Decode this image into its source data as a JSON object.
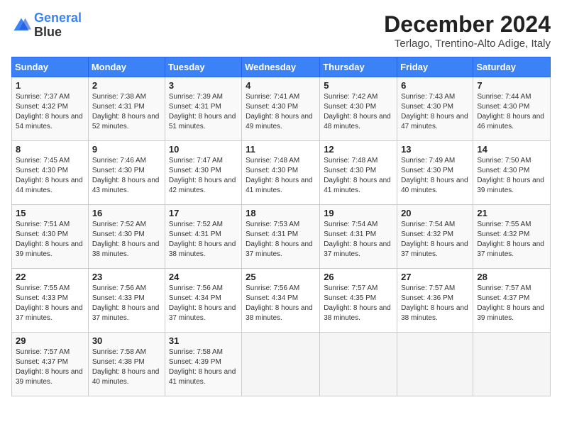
{
  "header": {
    "logo_line1": "General",
    "logo_line2": "Blue",
    "title": "December 2024",
    "subtitle": "Terlago, Trentino-Alto Adige, Italy"
  },
  "columns": [
    "Sunday",
    "Monday",
    "Tuesday",
    "Wednesday",
    "Thursday",
    "Friday",
    "Saturday"
  ],
  "weeks": [
    [
      {
        "day": "1",
        "sunrise": "7:37 AM",
        "sunset": "4:32 PM",
        "daylight": "8 hours and 54 minutes."
      },
      {
        "day": "2",
        "sunrise": "7:38 AM",
        "sunset": "4:31 PM",
        "daylight": "8 hours and 52 minutes."
      },
      {
        "day": "3",
        "sunrise": "7:39 AM",
        "sunset": "4:31 PM",
        "daylight": "8 hours and 51 minutes."
      },
      {
        "day": "4",
        "sunrise": "7:41 AM",
        "sunset": "4:30 PM",
        "daylight": "8 hours and 49 minutes."
      },
      {
        "day": "5",
        "sunrise": "7:42 AM",
        "sunset": "4:30 PM",
        "daylight": "8 hours and 48 minutes."
      },
      {
        "day": "6",
        "sunrise": "7:43 AM",
        "sunset": "4:30 PM",
        "daylight": "8 hours and 47 minutes."
      },
      {
        "day": "7",
        "sunrise": "7:44 AM",
        "sunset": "4:30 PM",
        "daylight": "8 hours and 46 minutes."
      }
    ],
    [
      {
        "day": "8",
        "sunrise": "7:45 AM",
        "sunset": "4:30 PM",
        "daylight": "8 hours and 44 minutes."
      },
      {
        "day": "9",
        "sunrise": "7:46 AM",
        "sunset": "4:30 PM",
        "daylight": "8 hours and 43 minutes."
      },
      {
        "day": "10",
        "sunrise": "7:47 AM",
        "sunset": "4:30 PM",
        "daylight": "8 hours and 42 minutes."
      },
      {
        "day": "11",
        "sunrise": "7:48 AM",
        "sunset": "4:30 PM",
        "daylight": "8 hours and 41 minutes."
      },
      {
        "day": "12",
        "sunrise": "7:48 AM",
        "sunset": "4:30 PM",
        "daylight": "8 hours and 41 minutes."
      },
      {
        "day": "13",
        "sunrise": "7:49 AM",
        "sunset": "4:30 PM",
        "daylight": "8 hours and 40 minutes."
      },
      {
        "day": "14",
        "sunrise": "7:50 AM",
        "sunset": "4:30 PM",
        "daylight": "8 hours and 39 minutes."
      }
    ],
    [
      {
        "day": "15",
        "sunrise": "7:51 AM",
        "sunset": "4:30 PM",
        "daylight": "8 hours and 39 minutes."
      },
      {
        "day": "16",
        "sunrise": "7:52 AM",
        "sunset": "4:30 PM",
        "daylight": "8 hours and 38 minutes."
      },
      {
        "day": "17",
        "sunrise": "7:52 AM",
        "sunset": "4:31 PM",
        "daylight": "8 hours and 38 minutes."
      },
      {
        "day": "18",
        "sunrise": "7:53 AM",
        "sunset": "4:31 PM",
        "daylight": "8 hours and 37 minutes."
      },
      {
        "day": "19",
        "sunrise": "7:54 AM",
        "sunset": "4:31 PM",
        "daylight": "8 hours and 37 minutes."
      },
      {
        "day": "20",
        "sunrise": "7:54 AM",
        "sunset": "4:32 PM",
        "daylight": "8 hours and 37 minutes."
      },
      {
        "day": "21",
        "sunrise": "7:55 AM",
        "sunset": "4:32 PM",
        "daylight": "8 hours and 37 minutes."
      }
    ],
    [
      {
        "day": "22",
        "sunrise": "7:55 AM",
        "sunset": "4:33 PM",
        "daylight": "8 hours and 37 minutes."
      },
      {
        "day": "23",
        "sunrise": "7:56 AM",
        "sunset": "4:33 PM",
        "daylight": "8 hours and 37 minutes."
      },
      {
        "day": "24",
        "sunrise": "7:56 AM",
        "sunset": "4:34 PM",
        "daylight": "8 hours and 37 minutes."
      },
      {
        "day": "25",
        "sunrise": "7:56 AM",
        "sunset": "4:34 PM",
        "daylight": "8 hours and 38 minutes."
      },
      {
        "day": "26",
        "sunrise": "7:57 AM",
        "sunset": "4:35 PM",
        "daylight": "8 hours and 38 minutes."
      },
      {
        "day": "27",
        "sunrise": "7:57 AM",
        "sunset": "4:36 PM",
        "daylight": "8 hours and 38 minutes."
      },
      {
        "day": "28",
        "sunrise": "7:57 AM",
        "sunset": "4:37 PM",
        "daylight": "8 hours and 39 minutes."
      }
    ],
    [
      {
        "day": "29",
        "sunrise": "7:57 AM",
        "sunset": "4:37 PM",
        "daylight": "8 hours and 39 minutes."
      },
      {
        "day": "30",
        "sunrise": "7:58 AM",
        "sunset": "4:38 PM",
        "daylight": "8 hours and 40 minutes."
      },
      {
        "day": "31",
        "sunrise": "7:58 AM",
        "sunset": "4:39 PM",
        "daylight": "8 hours and 41 minutes."
      },
      null,
      null,
      null,
      null
    ]
  ]
}
